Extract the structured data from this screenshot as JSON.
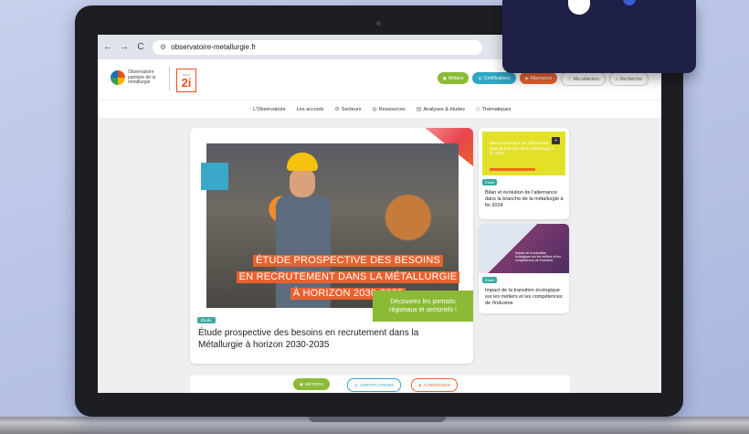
{
  "browser": {
    "url": "observatoire-metallurgie.fr",
    "back_icon": "←",
    "forward_icon": "→",
    "reload_icon": "C"
  },
  "header": {
    "logo_text": "Observatoire paritaire de la métallurgie",
    "opco_label": "OPCO",
    "opco_number": "2i",
    "buttons": {
      "metiers": "Métiers",
      "certifications": "Certifications",
      "alternance": "Alternance",
      "selection": "Ma sélection",
      "search": "Recherche"
    }
  },
  "nav": {
    "items": [
      {
        "label": "L'Observatoire"
      },
      {
        "label": "Les accords"
      },
      {
        "label": "Secteurs"
      },
      {
        "label": "Ressources"
      },
      {
        "label": "Analyses & études"
      },
      {
        "label": "Thématiques"
      }
    ]
  },
  "hero": {
    "title_lines": [
      "ÉTUDE PROSPECTIVE DES BESOINS",
      "EN RECRUTEMENT DANS LA MÉTALLURGIE",
      "À HORIZON 2030-2035"
    ],
    "promo": "Découvrez les portraits régionaux et sectoriels !",
    "badge": "Étude",
    "caption": "Étude prospective des besoins en recrutement dans la Métallurgie à horizon 2030-2035"
  },
  "side_cards": [
    {
      "image_text": "Bilan et évolution de l'alternance dans la branche de la métallurgie à fin 2024",
      "badge": "Étude",
      "title": "Bilan et évolution de l'alternance dans la branche de la métallurgie à fin 2024"
    },
    {
      "image_text": "Impact de la transition écologique sur les métiers et les compétences de l'industrie",
      "badge": "Étude",
      "title": "Impact de la transition écologique sur les métiers et les compétences de l'industrie"
    }
  ],
  "bottom_tabs": {
    "metiers": "MÉTIERS",
    "certifications": "CERTIFICATIONS",
    "alternance": "ALTERNANCE"
  },
  "colors": {
    "green": "#8bbb36",
    "cyan": "#2fa7c6",
    "orange": "#e8622f",
    "overlay": "#1e2048"
  }
}
